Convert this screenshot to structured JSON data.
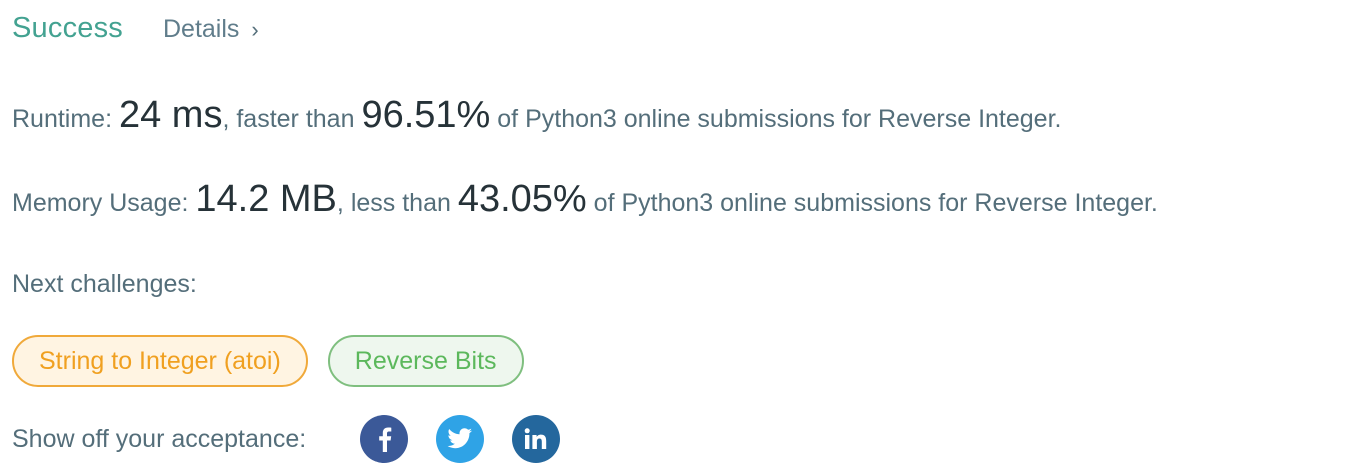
{
  "status": {
    "label": "Success",
    "color": "#43a291"
  },
  "details": {
    "label": "Details",
    "chevron": "›"
  },
  "runtime": {
    "prefix": "Runtime: ",
    "value": "24 ms",
    "mid": ", faster than ",
    "percent": "96.51%",
    "suffix": " of Python3 online submissions for Reverse Integer."
  },
  "memory": {
    "prefix": "Memory Usage: ",
    "value": "14.2 MB",
    "mid": ", less than ",
    "percent": "43.05%",
    "suffix": " of Python3 online submissions for Reverse Integer."
  },
  "next_challenges": {
    "label": "Next challenges:",
    "items": [
      {
        "label": "String to Integer (atoi)",
        "difficulty_color": "#f0a020"
      },
      {
        "label": "Reverse Bits",
        "difficulty_color": "#5cb85c"
      }
    ]
  },
  "share": {
    "label": "Show off your acceptance:",
    "icons": [
      {
        "name": "facebook-icon",
        "color": "#3b5998"
      },
      {
        "name": "twitter-icon",
        "color": "#2fa3e6"
      },
      {
        "name": "linkedin-icon",
        "color": "#24679d"
      }
    ]
  }
}
